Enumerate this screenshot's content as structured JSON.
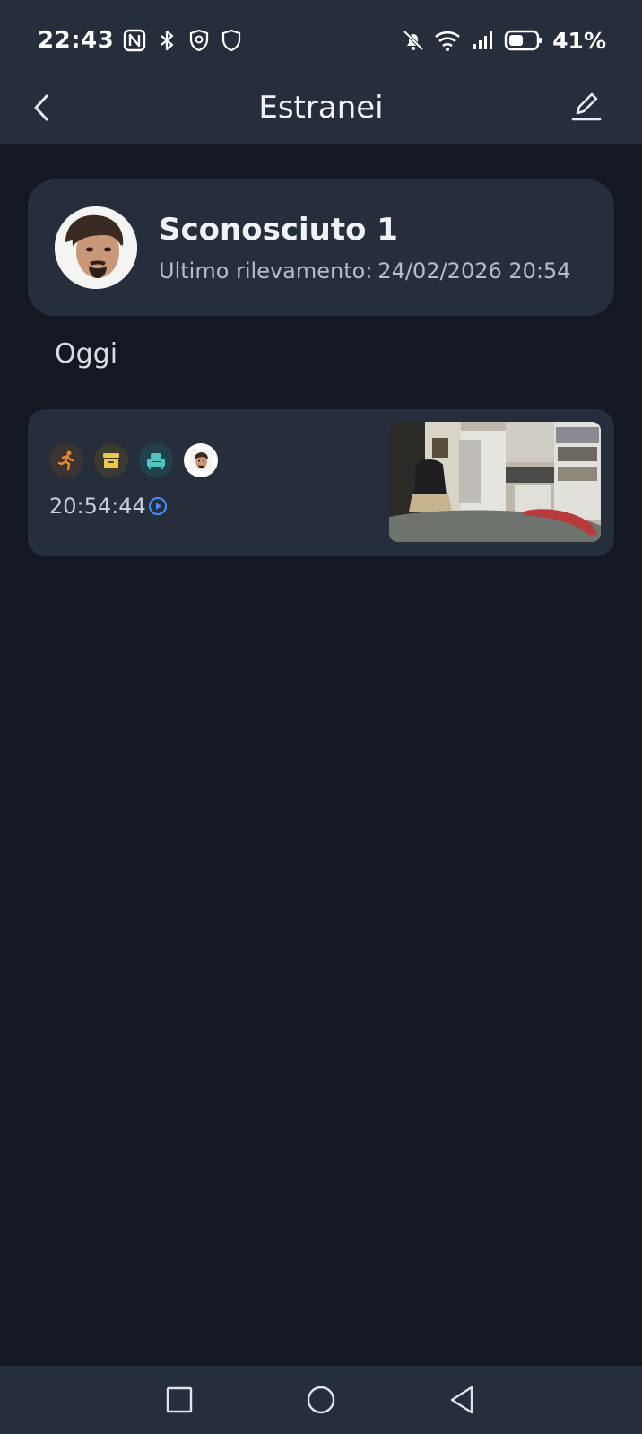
{
  "status_bar": {
    "time": "22:43",
    "battery": "41%",
    "icons": [
      "nfc-icon",
      "bluetooth-icon",
      "shield-badge-icon",
      "shield-icon",
      "bell-off-icon",
      "wifi-icon",
      "signal-icon",
      "battery-icon"
    ]
  },
  "app_bar": {
    "title": "Estranei",
    "back_icon": "chevron-left-icon",
    "edit_icon": "pencil-icon"
  },
  "person": {
    "name": "Sconosciuto 1",
    "last_detection_label": "Ultimo rilevamento:",
    "last_detection_value": "24/02/2026 20:54"
  },
  "section": {
    "label": "Oggi"
  },
  "events": [
    {
      "time": "20:54:44",
      "tags": [
        "motion-icon",
        "package-icon",
        "sofa-icon",
        "face-avatar"
      ]
    }
  ],
  "colors": {
    "background": "#131822",
    "surface": "#262e3c",
    "motion": "#e8892a",
    "package": "#f0c64a",
    "sofa": "#4fc3c1",
    "play": "#4a8cff"
  },
  "nav_bar": {
    "buttons": [
      "recents-icon",
      "home-icon",
      "back-icon"
    ]
  }
}
